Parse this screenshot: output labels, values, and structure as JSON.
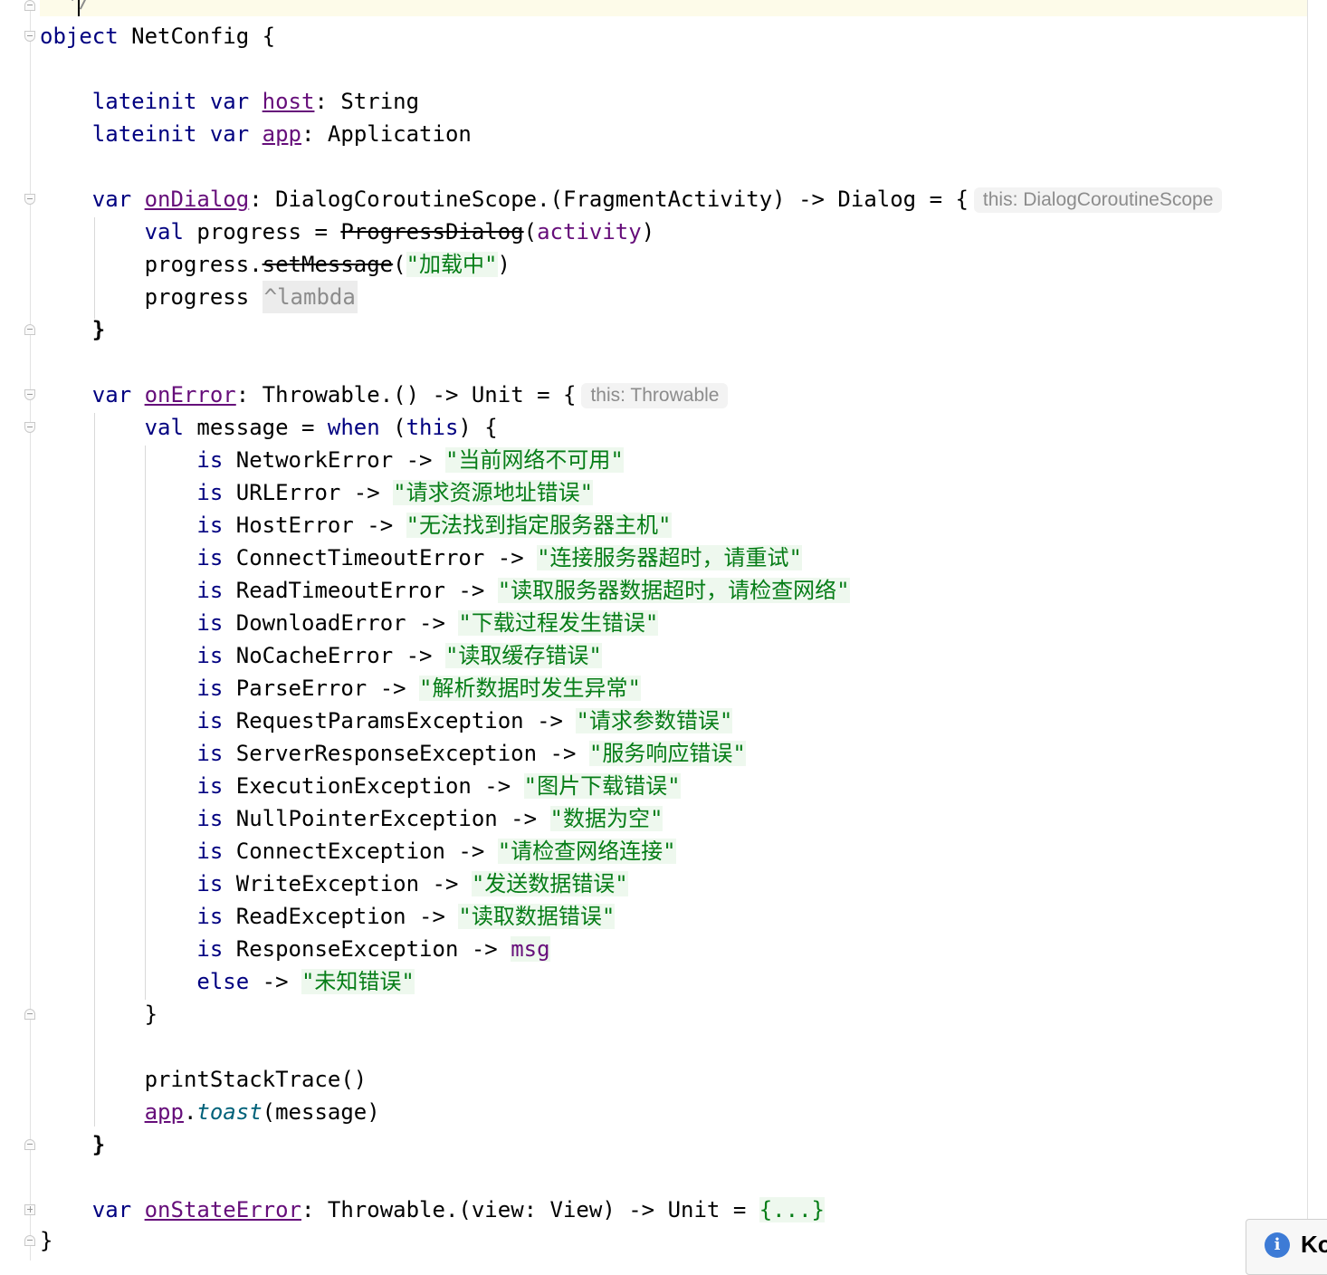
{
  "editor": {
    "comment_end": "*/",
    "lines": {
      "object_kw": "object",
      "object_name": "NetConfig {",
      "lateinit": "lateinit",
      "var": "var",
      "val": "val",
      "host": "host",
      "host_type": ": String",
      "app": "app",
      "app_type": ": Application",
      "onDialog": "onDialog",
      "onDialog_type": ": DialogCoroutineScope.(FragmentActivity) -> Dialog = {",
      "onDialog_hint": "this: DialogCoroutineScope",
      "progress_decl": " progress = ",
      "progress_dialog": "ProgressDialog",
      "paren_open": "(",
      "activity": "activity",
      "paren_close": ")",
      "progress_dot": "progress.",
      "setMessage": "setMessage",
      "loading_str": "\"加载中\"",
      "progress_word": "progress ",
      "lambda_hint": "^lambda",
      "close_brace": "}",
      "onError": "onError",
      "onError_type": ": Throwable.() -> Unit = {",
      "onError_hint": "this: Throwable",
      "message_decl": " message = ",
      "when": "when",
      "this": "this",
      "when_open": " (",
      "when_close": ") {",
      "is": "is",
      "else": "else",
      "arrow_sp": " -> ",
      "printStackTrace": "printStackTrace()",
      "toast": "toast",
      "toast_arg": "(message)",
      "dot": ".",
      "onStateError": "onStateError",
      "onStateError_type": ": Throwable.(view: View) -> Unit = ",
      "folded": "{...}"
    },
    "cases": [
      {
        "type": "NetworkError",
        "msg": "\"当前网络不可用\""
      },
      {
        "type": "URLError",
        "msg": "\"请求资源地址错误\""
      },
      {
        "type": "HostError",
        "msg": "\"无法找到指定服务器主机\""
      },
      {
        "type": "ConnectTimeoutError",
        "msg": "\"连接服务器超时，请重试\""
      },
      {
        "type": "ReadTimeoutError",
        "msg": "\"读取服务器数据超时，请检查网络\""
      },
      {
        "type": "DownloadError",
        "msg": "\"下载过程发生错误\""
      },
      {
        "type": "NoCacheError",
        "msg": "\"读取缓存错误\""
      },
      {
        "type": "ParseError",
        "msg": "\"解析数据时发生异常\""
      },
      {
        "type": "RequestParamsException",
        "msg": "\"请求参数错误\""
      },
      {
        "type": "ServerResponseException",
        "msg": "\"服务响应错误\""
      },
      {
        "type": "ExecutionException",
        "msg": "\"图片下载错误\""
      },
      {
        "type": "NullPointerException",
        "msg": "\"数据为空\""
      },
      {
        "type": "ConnectException",
        "msg": "\"请检查网络连接\""
      },
      {
        "type": "WriteException",
        "msg": "\"发送数据错误\""
      },
      {
        "type": "ReadException",
        "msg": "\"读取数据错误\""
      },
      {
        "type": "ResponseException",
        "msg": "msg"
      }
    ],
    "else_msg": "\"未知错误\""
  },
  "notification": {
    "icon": "info-icon",
    "text": "Ko"
  },
  "colors": {
    "keyword": "#000080",
    "property": "#660e7a",
    "string": "#067d17",
    "hint": "#8c8c8c"
  }
}
